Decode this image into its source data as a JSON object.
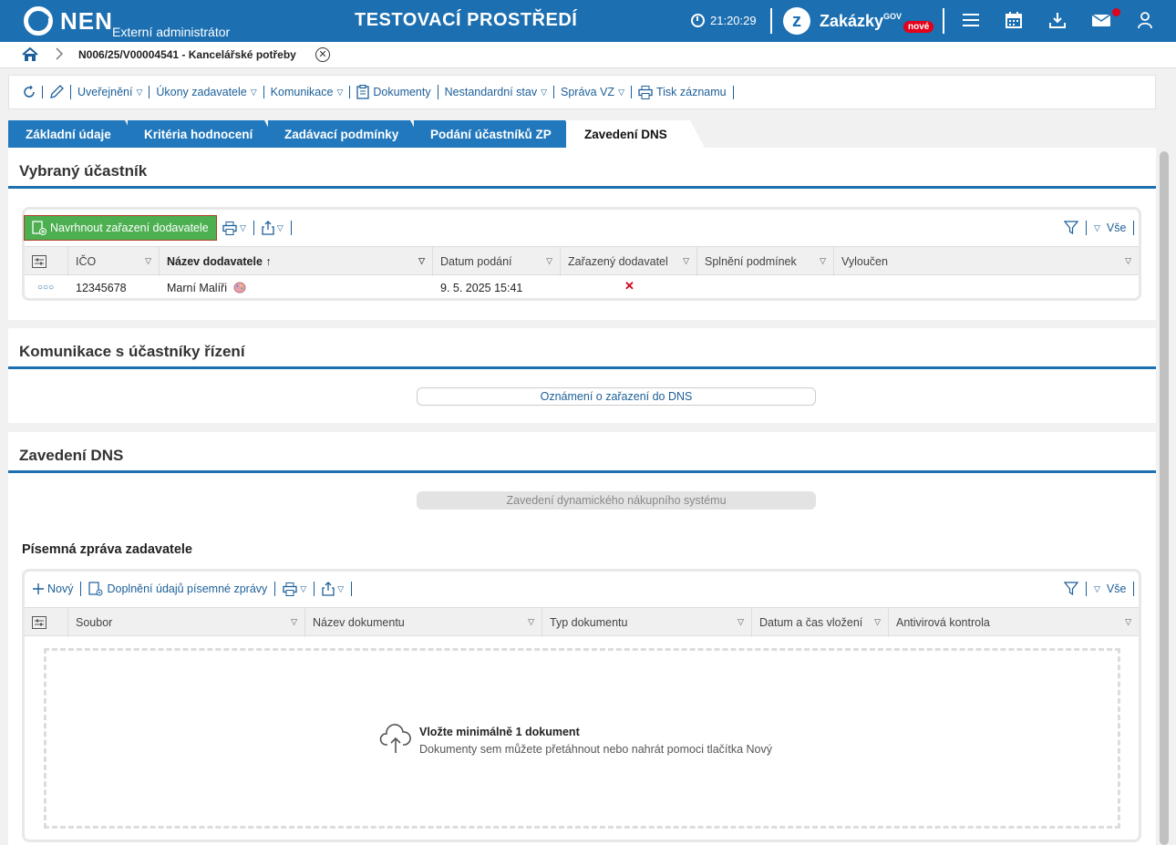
{
  "topbar": {
    "logo": "NEN",
    "subtitle": "Externí administrátor",
    "env_title": "TESTOVACÍ PROSTŘEDÍ",
    "time": "21:20:29",
    "zakazky": "Zakázky",
    "gov": "GOV",
    "nove": "nové",
    "accent": "#1c6fb1"
  },
  "breadcrumb": {
    "record": "N006/25/V00004541 - Kancelářské potřeby"
  },
  "toolbar": {
    "items": [
      "Uveřejnění",
      "Úkony zadavatele",
      "Komunikace",
      "Dokumenty",
      "Nestandardní stav",
      "Správa VZ",
      "Tisk záznamu"
    ]
  },
  "tabs": [
    "Základní údaje",
    "Kritéria hodnocení",
    "Zadávací podmínky",
    "Podání účastníků ZP",
    "Zavedení DNS"
  ],
  "vybrany": {
    "title": "Vybraný účastník",
    "action": "Navrhnout zařazení dodavatele",
    "filter_all": "Vše",
    "columns": [
      "IČO",
      "Název dodavatele",
      "Datum podání",
      "Zařazený dodavatel",
      "Splnění podmínek",
      "Vyloučen"
    ],
    "rows": [
      {
        "ico": "12345678",
        "nazev": "Marní Malíři",
        "datum": "9. 5. 2025 15:41",
        "zarazeny": "✕"
      }
    ]
  },
  "komunikace": {
    "title": "Komunikace s účastníky řízení",
    "button": "Oznámení o zařazení do DNS"
  },
  "zavedeni": {
    "title": "Zavedení DNS",
    "button": "Zavedení dynamického nákupního systému",
    "subsection": "Písemná zpráva zadavatele",
    "new": "Nový",
    "doplneni": "Doplnění údajů písemné zprávy",
    "filter_all": "Vše",
    "columns": [
      "Soubor",
      "Název dokumentu",
      "Typ dokumentu",
      "Datum a čas vložení",
      "Antivirová kontrola"
    ],
    "drop_title": "Vložte minimálně 1 dokument",
    "drop_sub": "Dokumenty sem můžete přetáhnout nebo nahrát pomoci tlačítka Nový"
  }
}
